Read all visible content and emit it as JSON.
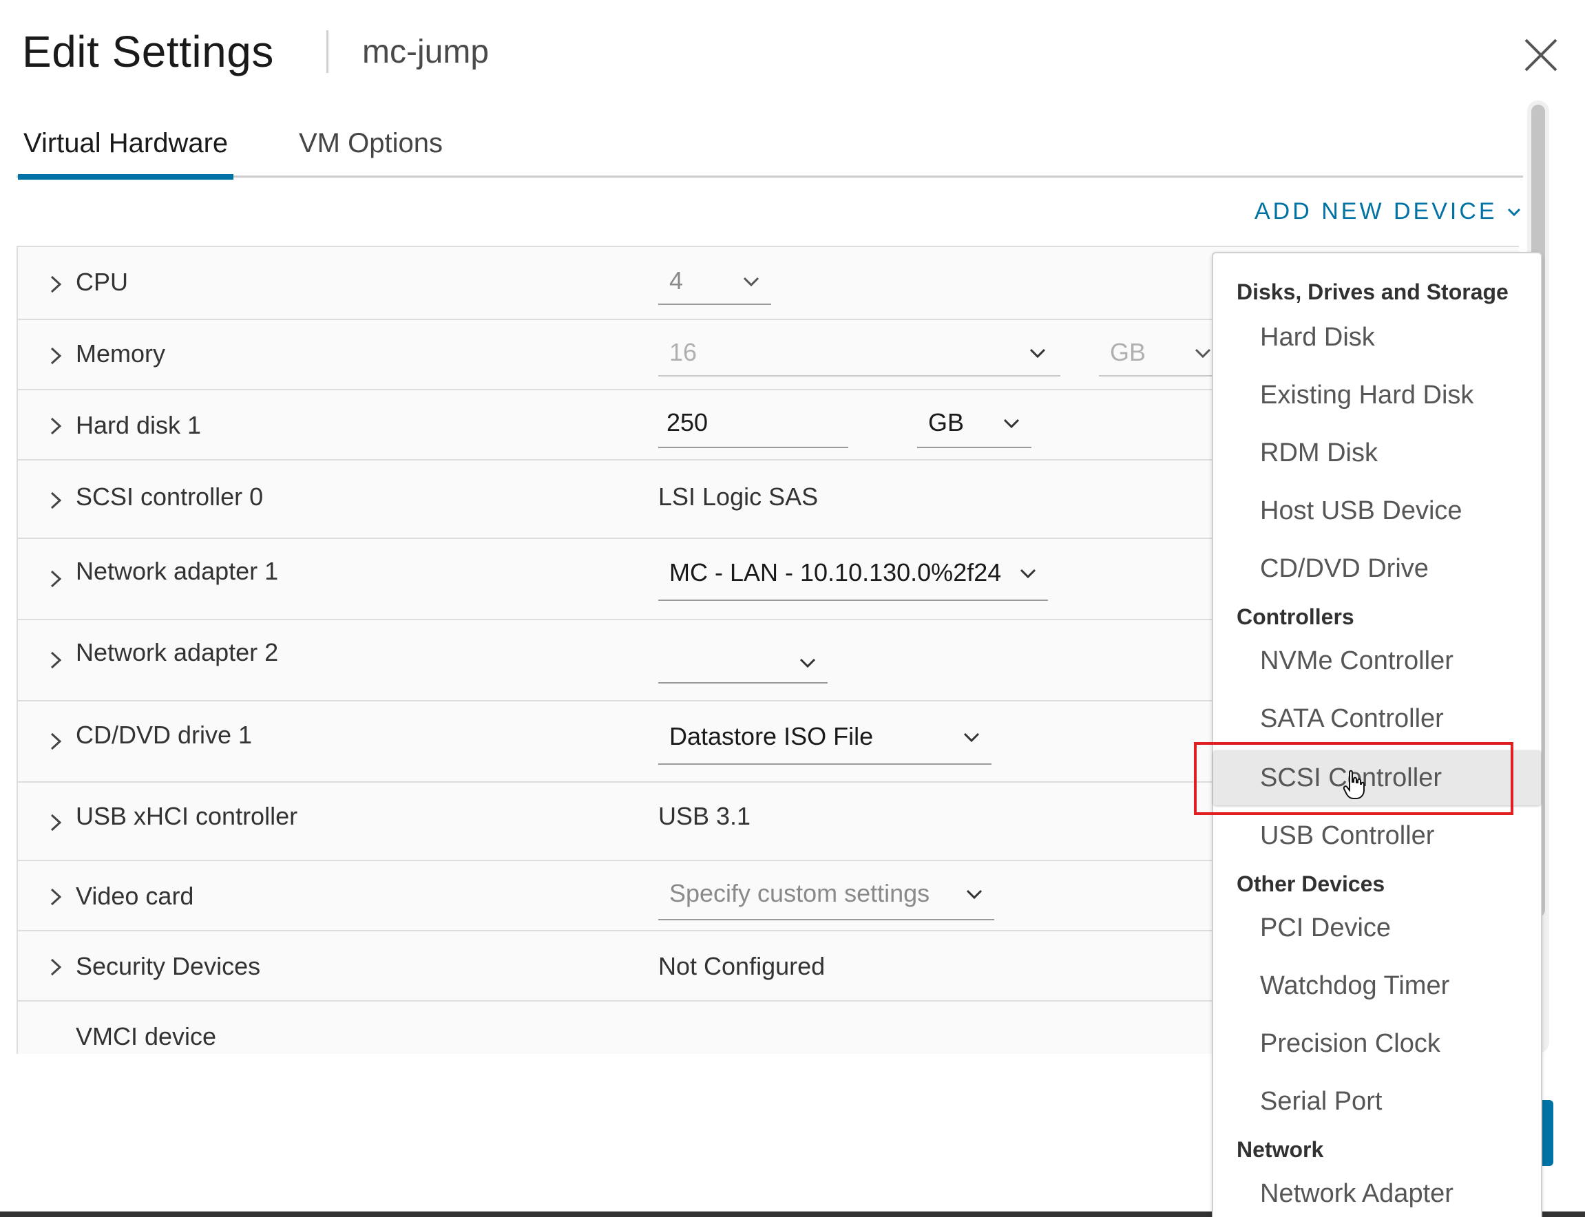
{
  "header": {
    "title": "Edit Settings",
    "vm_name": "mc-jump"
  },
  "tabs": [
    {
      "label": "Virtual Hardware",
      "active": true
    },
    {
      "label": "VM Options",
      "active": false
    }
  ],
  "add_device_label": "ADD NEW DEVICE",
  "hardware": {
    "cpu": {
      "label": "CPU",
      "value": "4"
    },
    "memory": {
      "label": "Memory",
      "value": "16",
      "unit": "GB"
    },
    "hard_disk": {
      "label": "Hard disk 1",
      "value": "250",
      "unit": "GB"
    },
    "scsi": {
      "label": "SCSI controller 0",
      "value": "LSI Logic SAS"
    },
    "net1": {
      "label": "Network adapter 1",
      "value": "MC - LAN - 10.10.130.0%2f24"
    },
    "net2": {
      "label": "Network adapter 2",
      "value": ""
    },
    "cddvd": {
      "label": "CD/DVD drive 1",
      "value": "Datastore ISO File"
    },
    "usb": {
      "label": "USB xHCI controller",
      "value": "USB 3.1"
    },
    "video": {
      "label": "Video card",
      "value": "Specify custom settings"
    },
    "security": {
      "label": "Security Devices",
      "value": "Not Configured"
    },
    "vmci": {
      "label": "VMCI device"
    }
  },
  "menu": {
    "groups": {
      "storage": "Disks, Drives and Storage",
      "controllers": "Controllers",
      "other": "Other Devices",
      "network": "Network"
    },
    "items": {
      "hard_disk": "Hard Disk",
      "existing_hard_disk": "Existing Hard Disk",
      "rdm_disk": "RDM Disk",
      "host_usb": "Host USB Device",
      "cd_dvd": "CD/DVD Drive",
      "nvme": "NVMe Controller",
      "sata": "SATA Controller",
      "scsi": "SCSI Controller",
      "usb_controller": "USB Controller",
      "pci": "PCI Device",
      "watchdog": "Watchdog Timer",
      "precision_clock": "Precision Clock",
      "serial_port": "Serial Port",
      "network_adapter": "Network Adapter"
    },
    "hovered_item": "SCSI Controller"
  },
  "colors": {
    "accent": "#0072a3",
    "highlight": "#e02020"
  }
}
